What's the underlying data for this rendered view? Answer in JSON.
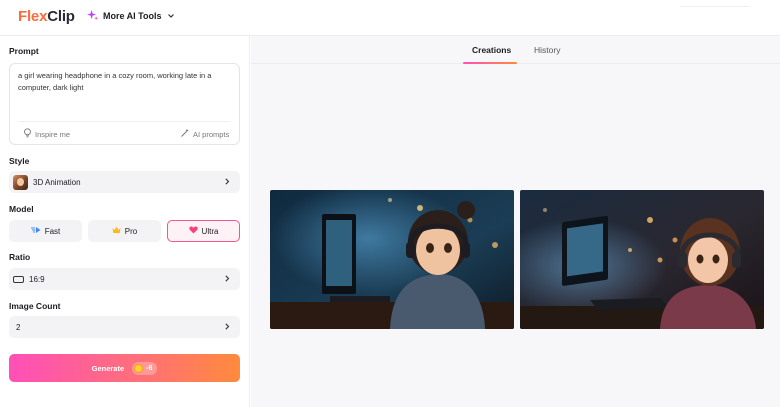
{
  "header": {
    "logo_prefix": "Flex",
    "logo_suffix": "Clip",
    "more_tools_label": "More AI Tools"
  },
  "prompt": {
    "label": "Prompt",
    "value": "a girl wearing headphone in a cozy room, working late in a computer, dark light",
    "inspire_label": "Inspire me",
    "ai_prompts_label": "AI prompts"
  },
  "style": {
    "label": "Style",
    "value": "3D Animation"
  },
  "model": {
    "label": "Model",
    "options": [
      "Fast",
      "Pro",
      "Ultra"
    ],
    "selected": "Ultra"
  },
  "ratio": {
    "label": "Ratio",
    "value": "16:9"
  },
  "image_count": {
    "label": "Image Count",
    "value": "2"
  },
  "generate": {
    "label": "Generate",
    "cost": "-6"
  },
  "tabs": {
    "items": [
      "Creations",
      "History"
    ],
    "active": "Creations"
  },
  "colors": {
    "accent_pink": "#ff4fb8",
    "accent_orange": "#ff8a3c",
    "logo_orange": "#ff6a3d"
  }
}
